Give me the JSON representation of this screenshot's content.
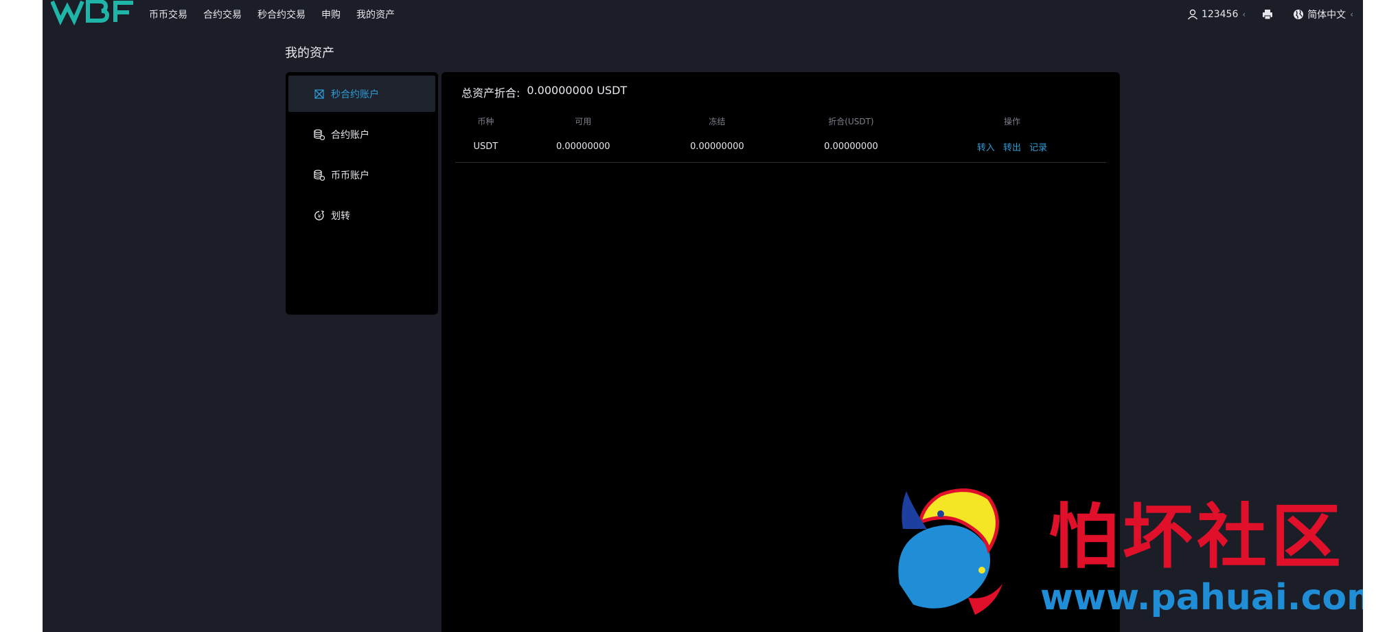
{
  "nav": {
    "links": [
      "币币交易",
      "合约交易",
      "秒合约交易",
      "申购",
      "我的资产"
    ],
    "user": "123456",
    "language": "简体中文"
  },
  "page_title": "我的资产",
  "sidebar": {
    "items": [
      {
        "label": "秒合约账户",
        "icon": "seconds-contract-icon",
        "active": true
      },
      {
        "label": "合约账户",
        "icon": "database-coin-icon",
        "active": false
      },
      {
        "label": "币币账户",
        "icon": "database-coin-icon",
        "active": false
      },
      {
        "label": "划转",
        "icon": "transfer-icon",
        "active": false
      }
    ]
  },
  "summary": {
    "label": "总资产折合:",
    "value": "0.00000000 USDT"
  },
  "table": {
    "headers": [
      "币种",
      "可用",
      "冻结",
      "折合(USDT)",
      "操作"
    ],
    "rows": [
      {
        "coin": "USDT",
        "available": "0.00000000",
        "frozen": "0.00000000",
        "equiv": "0.00000000",
        "ops": [
          "转入",
          "转出",
          "记录"
        ]
      }
    ]
  },
  "watermark": {
    "title": "怕坏社区",
    "url": "www.pahuai.com"
  },
  "colors": {
    "background": "#1b1e27",
    "panel": "#000000",
    "accent": "#2d9cd8",
    "brand": "#1fb5a8",
    "watermark_red": "#e0102a",
    "watermark_blue": "#1f8ed6"
  }
}
